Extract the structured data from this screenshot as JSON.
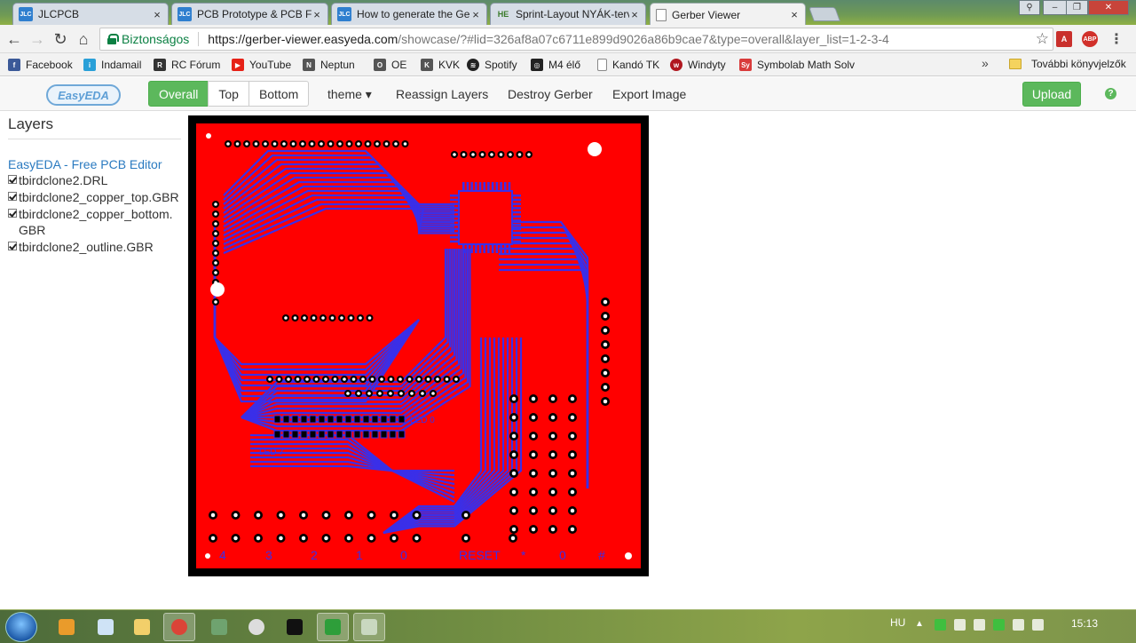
{
  "browser": {
    "tabs": [
      {
        "favicon": "jlc-icon",
        "title": "JLCPCB"
      },
      {
        "favicon": "jlc-icon",
        "title": "PCB Prototype & PCB Fab"
      },
      {
        "favicon": "jlc-icon",
        "title": "How to generate the Ger"
      },
      {
        "favicon": "he-icon",
        "title": "Sprint-Layout NYÁK-terv"
      },
      {
        "favicon": "document-icon",
        "title": "Gerber Viewer"
      }
    ],
    "active_tab": 4,
    "secure_label": "Biztonságos",
    "url_host": "https://gerber-viewer.easyeda.com",
    "url_rest": "/showcase/?#lid=326af8a07c6711e899d9026a86b9cae7&type=overall&layer_list=1-2-3-4"
  },
  "bookmarks": {
    "items": [
      {
        "label": "Facebook",
        "icon": "facebook-icon",
        "color": "#3b5998"
      },
      {
        "label": "Indamail",
        "icon": "info-icon",
        "color": "#2aa0d8"
      },
      {
        "label": "RC Fórum",
        "icon": "rc-icon",
        "color": "#333333"
      },
      {
        "label": "YouTube",
        "icon": "youtube-icon",
        "color": "#e62117"
      },
      {
        "label": "Neptun",
        "icon": "neptun-icon",
        "color": "#555555"
      },
      {
        "label": "OE",
        "icon": "oe-icon",
        "color": "#555555"
      },
      {
        "label": "KVK",
        "icon": "kvk-icon",
        "color": "#555555"
      },
      {
        "label": "Spotify",
        "icon": "spotify-icon",
        "color": "#222222"
      },
      {
        "label": "M4 élő",
        "icon": "m4-icon",
        "color": "#222222"
      },
      {
        "label": "Kandó TK",
        "icon": "page-icon",
        "color": "#888888"
      },
      {
        "label": "Windyty",
        "icon": "windyty-icon",
        "color": "#b0171f"
      },
      {
        "label": "Symbolab Math Solv",
        "icon": "symbolab-icon",
        "color": "#d93b3b"
      }
    ],
    "more_label": "»",
    "other_folder_label": "További könyvjelzők"
  },
  "toolbar": {
    "logo_text": "EasyEDA",
    "view_buttons": [
      "Overall",
      "Top",
      "Bottom"
    ],
    "active_view": 0,
    "menu": [
      "theme ▾",
      "Reassign Layers",
      "Destroy Gerber",
      "Export Image"
    ],
    "upload_label": "Upload",
    "help_label": "?"
  },
  "layers_panel": {
    "title": "Layers",
    "editor_link": "EasyEDA - Free PCB Editor",
    "layers": [
      {
        "name": "tbirdclone2.DRL",
        "checked": true
      },
      {
        "name": "tbirdclone2_copper_top.GBR",
        "checked": true
      },
      {
        "name": "tbirdclone2_copper_bottom.GBR",
        "checked": true
      },
      {
        "name": "tbirdclone2_outline.GBR",
        "checked": true
      }
    ]
  },
  "pcb": {
    "board_color": "#ff0000",
    "trace_color": "#3a2fe8",
    "silk_labels": [
      "LED 0",
      "LED 7"
    ],
    "bottom_labels": [
      "4",
      "3",
      "2",
      "1",
      "0",
      "RESET",
      "*",
      "0",
      "#"
    ]
  },
  "taskbar": {
    "language": "HU",
    "time": "15:13"
  }
}
